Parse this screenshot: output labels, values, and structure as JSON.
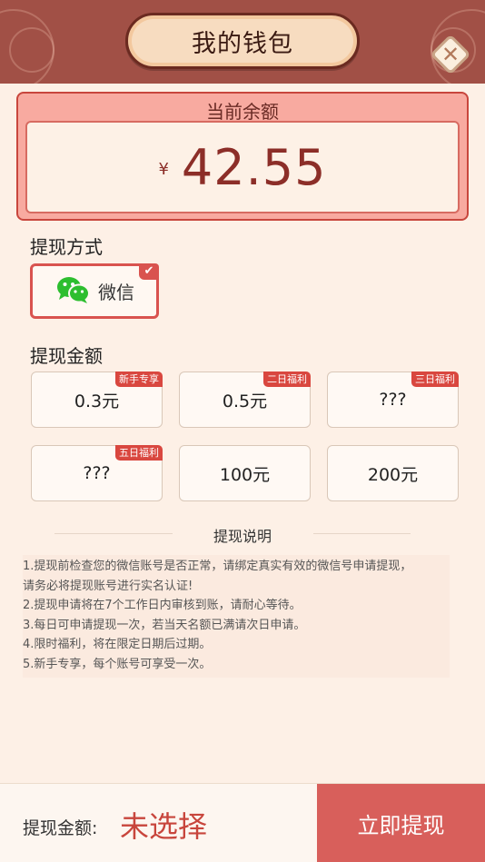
{
  "header": {
    "title": "我的钱包",
    "close_icon": "close-icon"
  },
  "balance": {
    "label": "当前余额",
    "currency": "¥",
    "amount": "42.55"
  },
  "method": {
    "title": "提现方式",
    "option_label": "微信",
    "option_icon": "wechat-icon",
    "selected": true
  },
  "amounts": {
    "title": "提现金额",
    "options": [
      {
        "value": "0.3元",
        "tag": "新手专享"
      },
      {
        "value": "0.5元",
        "tag": "二日福利"
      },
      {
        "value": "???",
        "tag": "三日福利"
      },
      {
        "value": "???",
        "tag": "五日福利"
      },
      {
        "value": "100元",
        "tag": ""
      },
      {
        "value": "200元",
        "tag": ""
      }
    ]
  },
  "notes": {
    "title": "提现说明",
    "lines": [
      "1.提现前检查您的微信账号是否正常，请绑定真实有效的微信号申请提现，",
      "请务必将提现账号进行实名认证!",
      "2.提现申请将在7个工作日内审核到账，请耐心等待。",
      "3.每日可申请提现一次，若当天名额已满请次日申请。",
      "4.限时福利，将在限定日期后过期。",
      "5.新手专享，每个账号可享受一次。"
    ]
  },
  "footer": {
    "amount_label": "提现金额:",
    "selected_text": "未选择",
    "button_label": "立即提现"
  },
  "colors": {
    "header_bg": "#a15046",
    "accent": "#d9534f",
    "page_bg": "#fdf0e6",
    "button_bg": "#d85f5b"
  }
}
